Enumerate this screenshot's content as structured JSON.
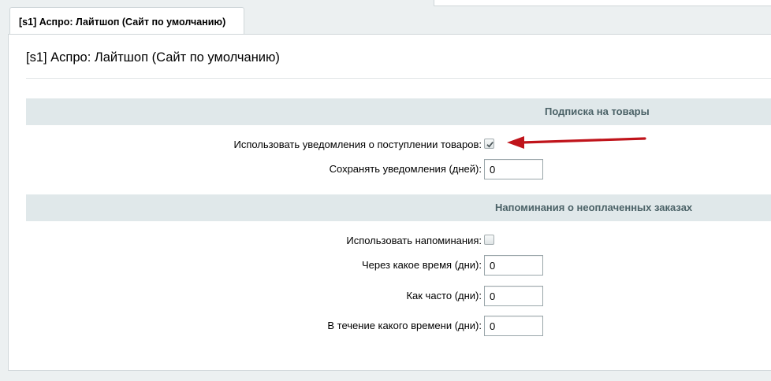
{
  "tab": {
    "label": "[s1] Аспро: Лайтшоп (Сайт по умолчанию)"
  },
  "panel": {
    "title": "[s1] Аспро: Лайтшоп (Сайт по умолчанию)"
  },
  "subscription": {
    "header": "Подписка на товары",
    "use_notifications": {
      "label": "Использовать уведомления о поступлении товаров:",
      "checked": true
    },
    "keep_days": {
      "label": "Сохранять уведомления (дней):",
      "value": "0"
    }
  },
  "reminders": {
    "header": "Напоминания о неоплаченных заказах",
    "use_reminders": {
      "label": "Использовать напоминания:",
      "checked": false
    },
    "after_days": {
      "label": "Через какое время (дни):",
      "value": "0"
    },
    "frequency": {
      "label": "Как часто (дни):",
      "value": "0"
    },
    "during_days": {
      "label": "В течение какого времени (дни):",
      "value": "0"
    }
  },
  "colors": {
    "section_header_bg": "#e0e8ea",
    "section_header_text": "#4b6267",
    "arrow": "#c0141b"
  }
}
